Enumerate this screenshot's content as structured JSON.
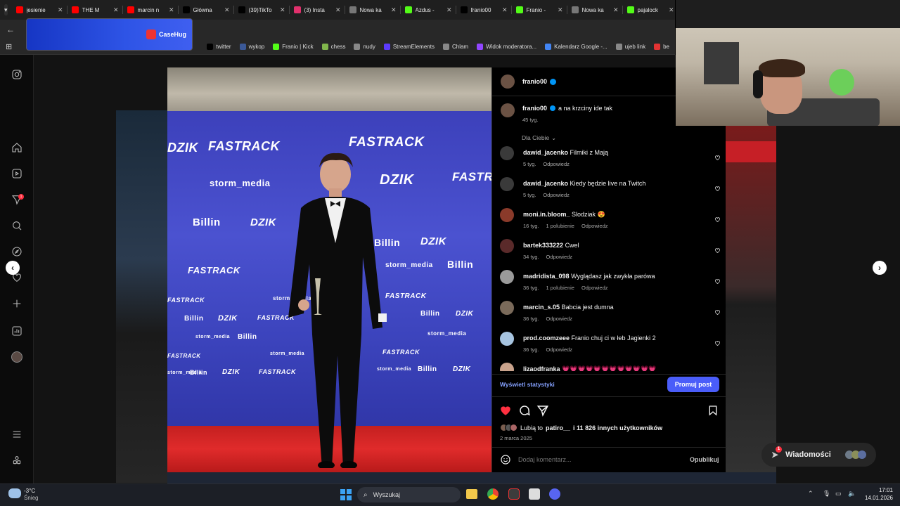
{
  "browser": {
    "tabs": [
      {
        "title": "jesienie",
        "color": "#ff0000"
      },
      {
        "title": "THE M",
        "color": "#ff0000"
      },
      {
        "title": "marcin n",
        "color": "#ff0000"
      },
      {
        "title": "Główna",
        "color": "#000000"
      },
      {
        "title": "(39)TikTo",
        "color": "#000000"
      },
      {
        "title": "(3) Insta",
        "color": "#e1306c"
      },
      {
        "title": "Nowa ka",
        "color": "#777777"
      },
      {
        "title": "Azdus - ",
        "color": "#53fc18"
      },
      {
        "title": "franio00",
        "color": "#000000"
      },
      {
        "title": "Franio -",
        "color": "#53fc18"
      },
      {
        "title": "Nowa ka",
        "color": "#777777"
      },
      {
        "title": "pajalock",
        "color": "#53fc18"
      }
    ],
    "bookmarks": [
      {
        "label": "twitter",
        "color": "#000000"
      },
      {
        "label": "wykop",
        "color": "#3b5998"
      },
      {
        "label": "Franio | Kick",
        "color": "#53fc18"
      },
      {
        "label": "chess",
        "color": "#81b64c"
      },
      {
        "label": "nudy",
        "color": "#888888"
      },
      {
        "label": "StreamElements",
        "color": "#5c3bfe"
      },
      {
        "label": "Chlam",
        "color": "#888888"
      },
      {
        "label": "Widok moderatora...",
        "color": "#9146ff"
      },
      {
        "label": "Kalendarz Google -...",
        "color": "#4285f4"
      },
      {
        "label": "ujeb link",
        "color": "#888888"
      },
      {
        "label": "be",
        "color": "#e33333"
      }
    ],
    "ad_brand": "CaseHug"
  },
  "post": {
    "author": "franio00",
    "caption": "a na krzciny ide tak",
    "caption_time": "45 tyg.",
    "sort_label": "Dla Ciebie",
    "comments": [
      {
        "user": "dawid_jacenko",
        "text": "Filmiki z Mają",
        "time": "5 tyg.",
        "likes": "",
        "reply": "Odpowiedz"
      },
      {
        "user": "dawid_jacenko",
        "text": "Kiedy będzie live na Twitch",
        "time": "5 tyg.",
        "likes": "",
        "reply": "Odpowiedz"
      },
      {
        "user": "moni.in.bloom_",
        "text": "Slodziak 😍",
        "time": "16 tyg.",
        "likes": "1 polubienie",
        "reply": "Odpowiedz"
      },
      {
        "user": "bartek333222",
        "text": "Cwel",
        "time": "34 tyg.",
        "likes": "",
        "reply": "Odpowiedz"
      },
      {
        "user": "madridista_098",
        "text": "Wyglądasz jak zwykła parówa",
        "time": "36 tyg.",
        "likes": "1 polubienie",
        "reply": "Odpowiedz"
      },
      {
        "user": "marcin_s.05",
        "text": "Babcia jest dumna",
        "time": "36 tyg.",
        "likes": "",
        "reply": "Odpowiedz"
      },
      {
        "user": "prod.coomzeee",
        "text": "Franio chuj ci w łeb Jagienki 2",
        "time": "36 tyg.",
        "likes": "",
        "reply": "Odpowiedz"
      },
      {
        "user": "lizaodfranka",
        "text": "💗💗💗💗💗💗💗💗💗💗💗💗",
        "time": "",
        "likes": "",
        "reply": ""
      }
    ],
    "view_stats": "Wyświetl statystyki",
    "promote": "Promuj post",
    "likes_prefix": "Lubią to",
    "likes_user": "patiro__",
    "likes_rest": "i 11 826 innych użytkowników",
    "date": "2 marca 2025",
    "comment_placeholder": "Dodaj komentarz...",
    "publish": "Opublikuj",
    "photo_brands": {
      "fastrack": "FASTRACK",
      "dzik": "DZIK",
      "storm": "storm_media",
      "billin": "Billin"
    }
  },
  "messages": {
    "label": "Wiadomości",
    "badge": "1"
  },
  "rail": {
    "notifications_badge": "1"
  },
  "taskbar": {
    "weather_temp": "-3°C",
    "weather_desc": "Śnieg",
    "search_label": "Wyszukaj",
    "time": "17:01",
    "date": "14.01.2026"
  },
  "colors": {
    "accent": "#4a5df9",
    "link": "#85a1ff",
    "like": "#ff3040"
  }
}
